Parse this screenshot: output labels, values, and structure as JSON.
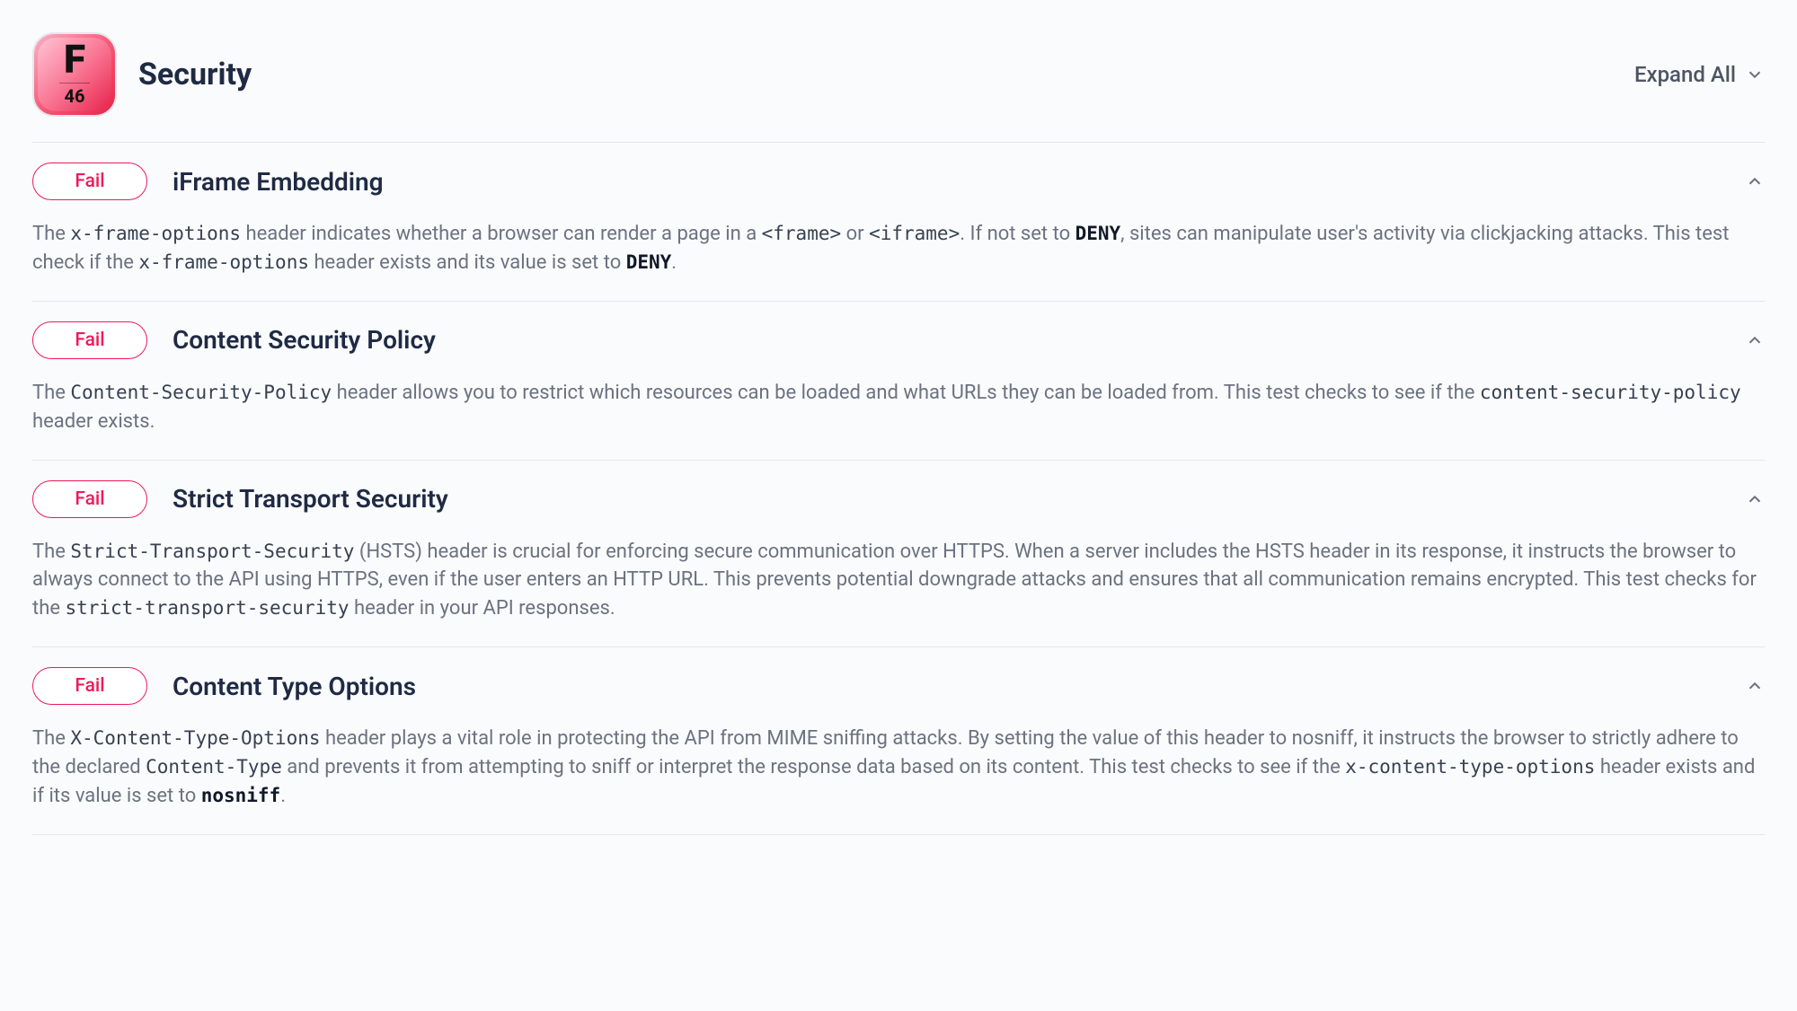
{
  "header": {
    "grade_letter": "F",
    "grade_score": "46",
    "title": "Security",
    "expand_all_label": "Expand All"
  },
  "items": [
    {
      "status": "Fail",
      "title": "iFrame Embedding",
      "desc_parts": [
        {
          "t": "text",
          "v": "The "
        },
        {
          "t": "code",
          "v": "x-frame-options"
        },
        {
          "t": "text",
          "v": " header indicates whether a browser can render a page in a "
        },
        {
          "t": "code",
          "v": "<frame>"
        },
        {
          "t": "text",
          "v": " or "
        },
        {
          "t": "code",
          "v": "<iframe>"
        },
        {
          "t": "text",
          "v": ". If not set to "
        },
        {
          "t": "mono",
          "v": "DENY"
        },
        {
          "t": "text",
          "v": ", sites can manipulate user's activity via clickjacking attacks. This test check if the "
        },
        {
          "t": "code",
          "v": "x-frame-options"
        },
        {
          "t": "text",
          "v": " header exists and its value is set to "
        },
        {
          "t": "mono",
          "v": "DENY"
        },
        {
          "t": "text",
          "v": "."
        }
      ]
    },
    {
      "status": "Fail",
      "title": "Content Security Policy",
      "desc_parts": [
        {
          "t": "text",
          "v": "The "
        },
        {
          "t": "code",
          "v": "Content-Security-Policy"
        },
        {
          "t": "text",
          "v": " header allows you to restrict which resources can be loaded and what URLs they can be loaded from. This test checks to see if the "
        },
        {
          "t": "code",
          "v": "content-security-policy"
        },
        {
          "t": "text",
          "v": " header exists."
        }
      ]
    },
    {
      "status": "Fail",
      "title": "Strict Transport Security",
      "desc_parts": [
        {
          "t": "text",
          "v": "The "
        },
        {
          "t": "code",
          "v": "Strict-Transport-Security"
        },
        {
          "t": "text",
          "v": " (HSTS) header is crucial for enforcing secure communication over HTTPS. When a server includes the HSTS header in its response, it instructs the browser to always connect to the API using HTTPS, even if the user enters an HTTP URL. This prevents potential downgrade attacks and ensures that all communication remains encrypted. This test checks for the "
        },
        {
          "t": "code",
          "v": "strict-transport-security"
        },
        {
          "t": "text",
          "v": " header in your API responses."
        }
      ]
    },
    {
      "status": "Fail",
      "title": "Content Type Options",
      "desc_parts": [
        {
          "t": "text",
          "v": "The "
        },
        {
          "t": "code",
          "v": "X-Content-Type-Options"
        },
        {
          "t": "text",
          "v": " header plays a vital role in protecting the API from MIME sniffing attacks. By setting the value of this header to nosniff, it instructs the browser to strictly adhere to the declared "
        },
        {
          "t": "code",
          "v": "Content-Type"
        },
        {
          "t": "text",
          "v": " and prevents it from attempting to sniff or interpret the response data based on its content. This test checks to see if the "
        },
        {
          "t": "code",
          "v": "x-content-type-options"
        },
        {
          "t": "text",
          "v": " header exists and if its value is set to "
        },
        {
          "t": "mono",
          "v": "nosniff"
        },
        {
          "t": "text",
          "v": "."
        }
      ]
    }
  ]
}
